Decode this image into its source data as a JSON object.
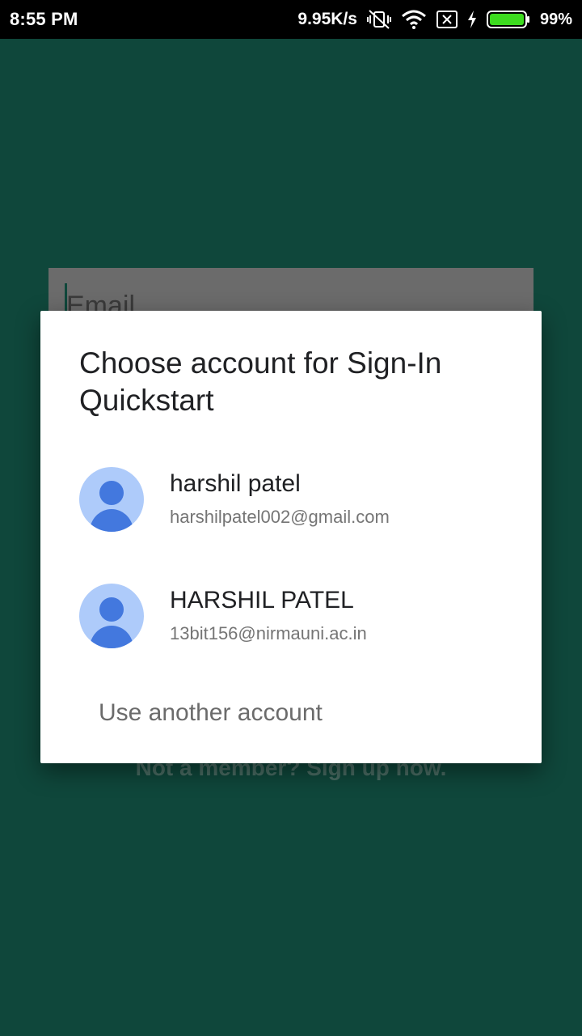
{
  "status_bar": {
    "time": "8:55 PM",
    "net_speed": "9.95K/s",
    "battery_percent": "99%",
    "icons": [
      "vibrate-off-icon",
      "wifi-icon",
      "no-sim-icon",
      "charging-icon",
      "battery-icon"
    ]
  },
  "background": {
    "email_placeholder": "Email",
    "signup_text": "Not a member? Sign up now."
  },
  "dialog": {
    "title": "Choose account for Sign-In Quickstart",
    "accounts": [
      {
        "name": "harshil patel",
        "email": "harshilpatel002@gmail.com"
      },
      {
        "name": "HARSHIL PATEL",
        "email": "13bit156@nirmauni.ac.in"
      }
    ],
    "use_another": "Use another account"
  },
  "colors": {
    "app_background": "#0f473b",
    "avatar_bg": "#aecbfa",
    "avatar_fg": "#4378de",
    "battery_green": "#3ddc1f"
  }
}
